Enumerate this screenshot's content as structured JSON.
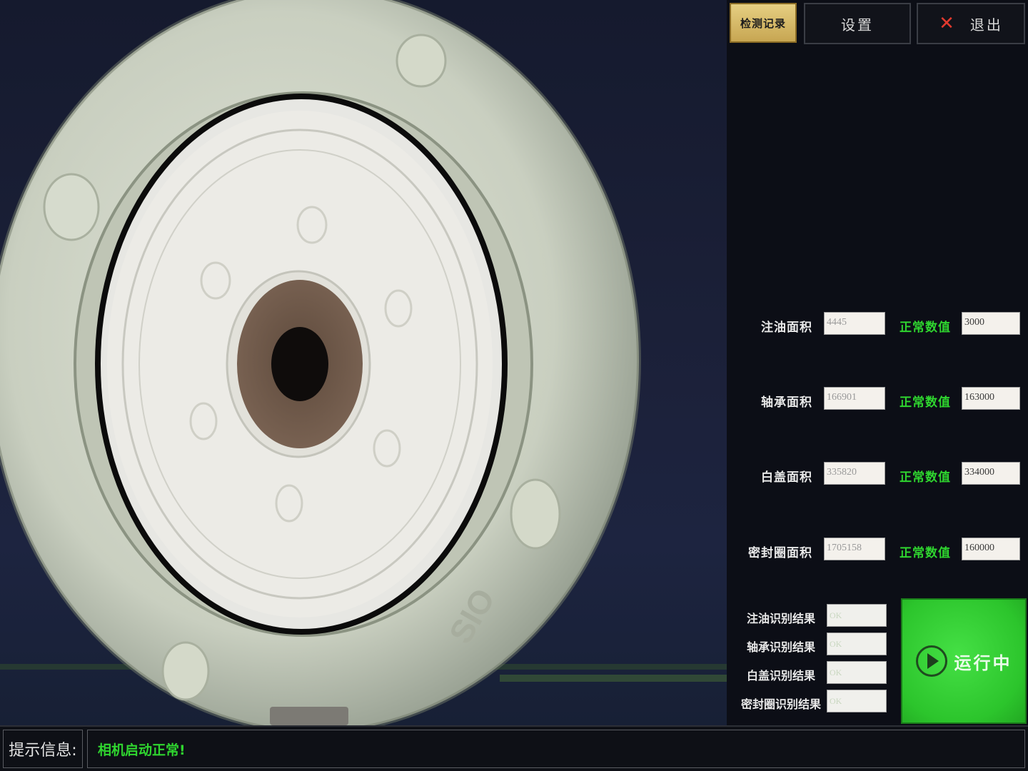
{
  "toolbar": {
    "records_label": "检测记录",
    "settings_label": "设置",
    "exit_label": "退出",
    "exit_icon": "x-icon",
    "accent_records": "#d8bd6a"
  },
  "measurements": [
    {
      "label": "注油面积",
      "value": "4445",
      "normal_label": "正常数值",
      "normal_value": "3000"
    },
    {
      "label": "轴承面积",
      "value": "166901",
      "normal_label": "正常数值",
      "normal_value": "163000"
    },
    {
      "label": "白盖面积",
      "value": "335820",
      "normal_label": "正常数值",
      "normal_value": "334000"
    },
    {
      "label": "密封圈面积",
      "value": "1705158",
      "normal_label": "正常数值",
      "normal_value": "160000"
    }
  ],
  "results": [
    {
      "label": "注油识别结果",
      "value": "OK"
    },
    {
      "label": "轴承识别结果",
      "value": "OK"
    },
    {
      "label": "白盖识别结果",
      "value": "OK"
    },
    {
      "label": "密封圈识别结果",
      "value": "OK"
    }
  ],
  "run_button": {
    "label": "运行中",
    "icon": "play-icon",
    "color": "#2cc52c"
  },
  "status": {
    "label": "提示信息:",
    "message": "相机启动正常!",
    "message_color": "#2fd52f"
  },
  "camera": {
    "part_marking": "SIO"
  }
}
